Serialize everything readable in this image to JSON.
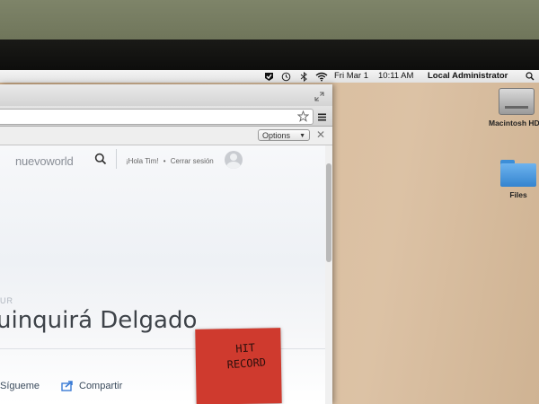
{
  "menubar": {
    "date": "Fri Mar 1",
    "time": "10:11 AM",
    "user": "Local Administrator"
  },
  "desktop": {
    "icons": [
      {
        "label": "Macintosh HD",
        "icon": "hard-drive-icon"
      },
      {
        "label": "Files",
        "icon": "folder-icon"
      }
    ]
  },
  "browser": {
    "options_label": "Options",
    "site": {
      "logo": "nuevoworld",
      "greeting": "¡Hola Tim!",
      "separator": "•",
      "logout": "Cerrar sesión"
    },
    "article": {
      "kicker": "OUR",
      "title": "uinquirá Delgado",
      "follow_label": "Sígueme",
      "share_label": "Compartir"
    }
  },
  "sticky_note": {
    "line1": "HIT",
    "line2": "RECORD"
  },
  "colors": {
    "sticky": "#cf3a2e",
    "share_icon": "#3a7bd5",
    "desktop": "#d8bc9c"
  }
}
